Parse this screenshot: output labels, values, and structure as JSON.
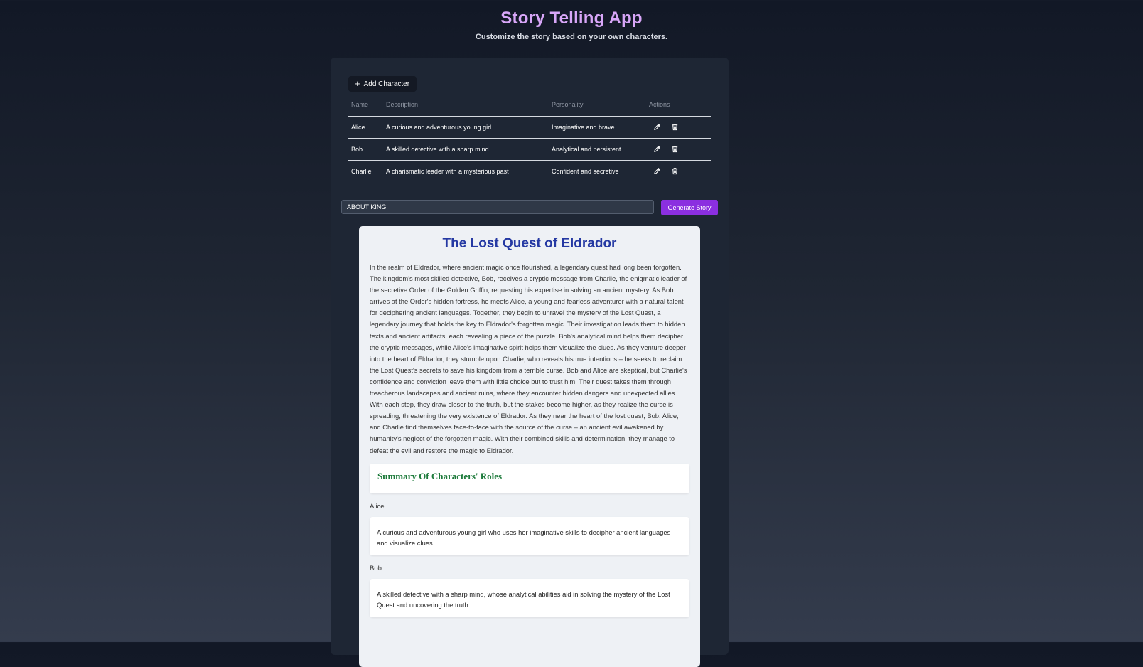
{
  "header": {
    "title": "Story Telling App",
    "subtitle": "Customize the story based on your own characters."
  },
  "toolbar": {
    "add_character_label": "Add Character"
  },
  "table": {
    "columns": [
      "Name",
      "Description",
      "Personality",
      "Actions"
    ],
    "rows": [
      {
        "name": "Alice",
        "description": "A curious and adventurous young girl",
        "personality": "Imaginative and brave"
      },
      {
        "name": "Bob",
        "description": "A skilled detective with a sharp mind",
        "personality": "Analytical and persistent"
      },
      {
        "name": "Charlie",
        "description": "A charismatic leader with a mysterious past",
        "personality": "Confident and secretive"
      }
    ],
    "action_icons": [
      "pencil-icon",
      "trash-icon"
    ]
  },
  "prompt": {
    "value": "ABOUT KING",
    "generate_label": "Generate Story"
  },
  "story": {
    "title": "The Lost Quest of Eldrador",
    "body": "In the realm of Eldrador, where ancient magic once flourished, a legendary quest had long been forgotten. The kingdom's most skilled detective, Bob, receives a cryptic message from Charlie, the enigmatic leader of the secretive Order of the Golden Griffin, requesting his expertise in solving an ancient mystery. As Bob arrives at the Order's hidden fortress, he meets Alice, a young and fearless adventurer with a natural talent for deciphering ancient languages. Together, they begin to unravel the mystery of the Lost Quest, a legendary journey that holds the key to Eldrador's forgotten magic. Their investigation leads them to hidden texts and ancient artifacts, each revealing a piece of the puzzle. Bob's analytical mind helps them decipher the cryptic messages, while Alice's imaginative spirit helps them visualize the clues. As they venture deeper into the heart of Eldrador, they stumble upon Charlie, who reveals his true intentions – he seeks to reclaim the Lost Quest's secrets to save his kingdom from a terrible curse. Bob and Alice are skeptical, but Charlie's confidence and conviction leave them with little choice but to trust him. Their quest takes them through treacherous landscapes and ancient ruins, where they encounter hidden dangers and unexpected allies. With each step, they draw closer to the truth, but the stakes become higher, as they realize the curse is spreading, threatening the very existence of Eldrador. As they near the heart of the lost quest, Bob, Alice, and Charlie find themselves face-to-face with the source of the curse – an ancient evil awakened by humanity's neglect of the forgotten magic. With their combined skills and determination, they manage to defeat the evil and restore the magic to Eldrador.",
    "summary_title": "Summary Of Characters' Roles",
    "roles": [
      {
        "name": "Alice",
        "text": "A curious and adventurous young girl who uses her imaginative skills to decipher ancient languages and visualize clues."
      },
      {
        "name": "Bob",
        "text": "A skilled detective with a sharp mind, whose analytical abilities aid in solving the mystery of the Lost Quest and uncovering the truth."
      }
    ]
  },
  "colors": {
    "accent": "#8b2fe0",
    "title": "#d8a6f8",
    "story_title": "#2539a3",
    "summary_title": "#1c7a3a"
  }
}
